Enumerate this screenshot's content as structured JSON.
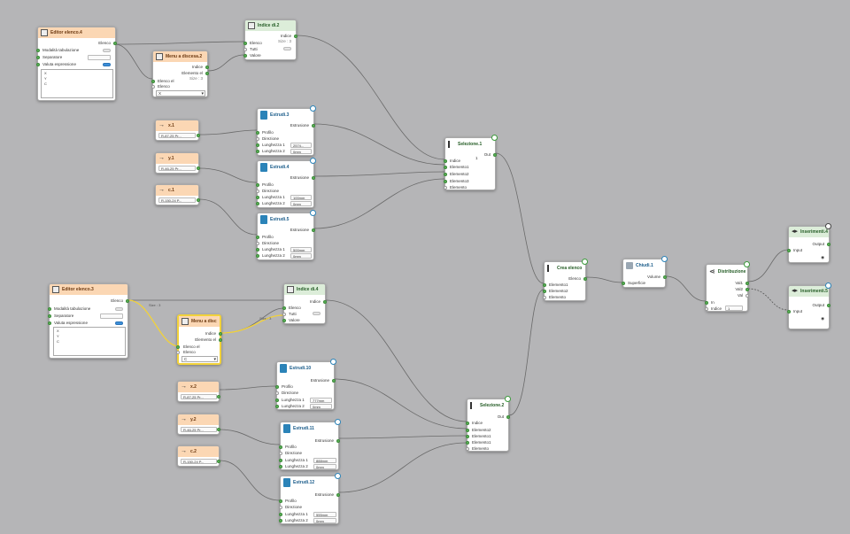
{
  "nodes": {
    "editorA": {
      "title": "Editor elenco.4",
      "out": "Elenco",
      "rows": [
        "Modalità tabulazione",
        "Separatore",
        "Valuta espressione"
      ],
      "items": [
        "X",
        "Y",
        "C"
      ]
    },
    "menuA": {
      "title": "Menu a discesa.2",
      "out1": "Indice",
      "out2": "Elemento el",
      "out3": "Size : 3",
      "in1": "Elenco el",
      "in2": "Elenco",
      "value": "X"
    },
    "indiceA": {
      "title": "Indice di.2",
      "out1": "Indice",
      "out2": "Size : 3",
      "in1": "Elenco",
      "in2": "Tutti",
      "in3": "Valore"
    },
    "vA1": {
      "title": "x.1",
      "value": "R-87-25 Pr..."
    },
    "vA2": {
      "title": "y.1",
      "value": "R-46-25 Pr..."
    },
    "vA3": {
      "title": "c.1",
      "value": "R-150-24 P..."
    },
    "estA1": {
      "title": "Estrudi.3",
      "out": "Estrusione",
      "r1": "Profilo",
      "r2": "Direzione",
      "r3": "Lunghezza 1",
      "r4": "Lunghezza 2",
      "v3": "2574...",
      "v4": "0mm"
    },
    "estA2": {
      "title": "Estrudi.4",
      "out": "Estrusione",
      "r1": "Profilo",
      "r2": "Direzione",
      "r3": "Lunghezza 1",
      "r4": "Lunghezza 2",
      "v3": "100mm",
      "v4": "0mm"
    },
    "estA3": {
      "title": "Estrudi.5",
      "out": "Estrusione",
      "r1": "Profilo",
      "r2": "Direzione",
      "r3": "Lunghezza 1",
      "r4": "Lunghezza 2",
      "v3": "500mm",
      "v4": "0mm"
    },
    "selA": {
      "title": "Selezione.1",
      "out": "Out",
      "r1": "Indice",
      "v1": "1",
      "r2": "Elemento1",
      "r3": "Elemento2",
      "r4": "Elemento3",
      "r5": "Elemento"
    },
    "creaList": {
      "title": "Crea elenco",
      "out": "Elenco",
      "r1": "Elemento1",
      "r2": "Elemento2",
      "r3": "Elemento"
    },
    "chiudi": {
      "title": "Chiudi.1",
      "out": "Volume",
      "in": "Superficie"
    },
    "distrib": {
      "title": "Distribuzione",
      "o1": "Val1",
      "o2": "Val2",
      "o3": "Val",
      "in1": "In",
      "in2": "Indice",
      "v2": "1"
    },
    "ins4": {
      "title": "Inserimenti.4",
      "out": "Output",
      "in": "Input"
    },
    "ins5": {
      "title": "Inserimenti.5",
      "out": "Output",
      "in": "Input"
    },
    "editorB": {
      "title": "Editor elenco.3",
      "out": "Elenco",
      "rows": [
        "Modalità tabulazione",
        "Separatore",
        "Valuta espressione"
      ],
      "items": [
        "X",
        "Y",
        "C"
      ]
    },
    "menuB": {
      "title": "Menu a disc",
      "out1": "Indice",
      "out2": "Elemento el",
      "in1": "Elenco el",
      "in2": "Elenco",
      "value": "C"
    },
    "indiceB": {
      "title": "Indice di.4",
      "out1": "Indice",
      "in1": "Elenco",
      "in2": "Tutti",
      "in3": "Valore"
    },
    "vB1": {
      "title": "x.2",
      "value": "R-87-25 Pr..."
    },
    "vB2": {
      "title": "y.2",
      "value": "R-46-25 Pr..."
    },
    "vB3": {
      "title": "c.2",
      "value": "R-150-24 P..."
    },
    "estB1": {
      "title": "Estrudi.10",
      "out": "Estrusione",
      "r1": "Profilo",
      "r2": "Direzione",
      "r3": "Lunghezza 1",
      "r4": "Lunghezza 2",
      "v3": "777mm",
      "v4": "0mm"
    },
    "estB2": {
      "title": "Estrudi.11",
      "out": "Estrusione",
      "r1": "Profilo",
      "r2": "Direzione",
      "r3": "Lunghezza 1",
      "r4": "Lunghezza 2",
      "v3": "888mm",
      "v4": "0mm"
    },
    "estB3": {
      "title": "Estrudi.12",
      "out": "Estrusione",
      "r1": "Profilo",
      "r2": "Direzione",
      "r3": "Lunghezza 1",
      "r4": "Lunghezza 2",
      "v3": "555mm",
      "v4": "0mm"
    },
    "selB": {
      "title": "Selezione.2",
      "out": "Out",
      "r1": "Indice",
      "r2": "Elemento2",
      "r3": "Elemento1",
      "r4": "Elemento1",
      "r5": "Elemento"
    }
  },
  "wire_labels": {
    "a": "Size : 3",
    "b": "Size : 3"
  }
}
